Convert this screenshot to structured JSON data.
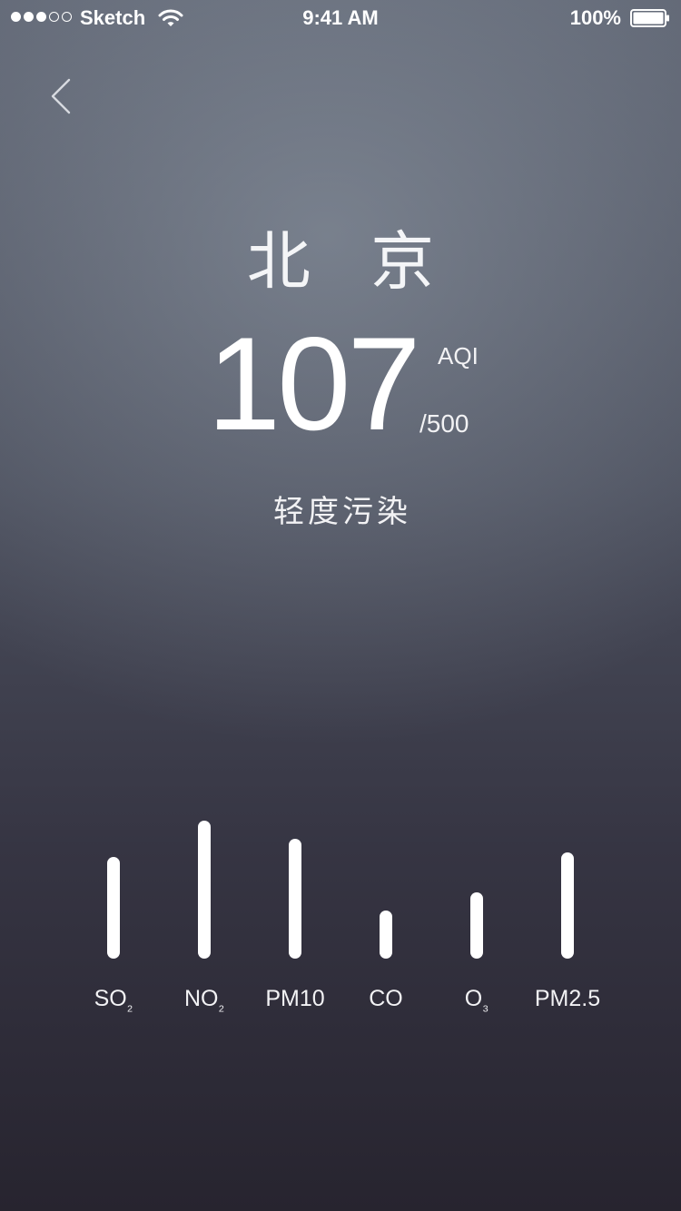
{
  "status_bar": {
    "signal_bars_filled": 3,
    "signal_bars_total": 5,
    "carrier": "Sketch",
    "wifi_icon": "wifi-icon",
    "time": "9:41 AM",
    "battery_percent": "100%",
    "battery_level": 1.0,
    "battery_icon": "battery-icon"
  },
  "nav": {
    "back_icon": "chevron-left-icon"
  },
  "city": "北 京",
  "aqi": {
    "value": "107",
    "label": "AQI",
    "max": "/500",
    "level": "轻度污染"
  },
  "pollutants": [
    {
      "name": "SO",
      "subscript": "₂",
      "level": 0.74
    },
    {
      "name": "NO",
      "subscript": "₂",
      "level": 1.0
    },
    {
      "name": "PM10",
      "subscript": "",
      "level": 0.87
    },
    {
      "name": "CO",
      "subscript": "",
      "level": 0.35
    },
    {
      "name": "O",
      "subscript": "₃",
      "level": 0.48
    },
    {
      "name": "PM2.5",
      "subscript": "",
      "level": 0.77
    }
  ],
  "colors": {
    "background_top": "#5d6371",
    "background_bottom": "#27242f",
    "foreground": "#ffffff"
  }
}
